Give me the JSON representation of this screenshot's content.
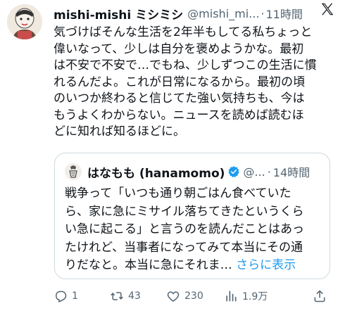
{
  "author": {
    "name": "mishi-mishi ミシミシ",
    "handle": "@mishi_mi...",
    "separator": "·",
    "time": "11時間"
  },
  "body_lines": [
    "気づけばそんな生活を2年半もしてる私ちょっと",
    "偉いなって、少しは自分を褒めようかな。最初",
    "は不安で不安で…でもね、少しずつこの生活に慣",
    "れるんだよ。これが日常になるから。最初の頃",
    "のいつか終わると信じてた強い気持ちも、今は",
    "もうよくわからない。ニュースを読めば読むほ",
    "どに知れば知るほどに。"
  ],
  "quote": {
    "name": "はなもも (hanamomo)",
    "handle": "@...",
    "separator": "·",
    "time": "14時間",
    "lines": [
      "戦争って「いつも通り朝ごはん食べていた",
      "ら、家に急にミサイル落ちてきたというくら",
      "い急に起こる」と言うのを読んだことはあっ",
      "たけれど、当事者になってみて本当にその通"
    ],
    "last_line": "りだなと。本当に急にそれま… ",
    "show_more": "さらに表示"
  },
  "actions": {
    "replies": "1",
    "reposts": "43",
    "likes": "230",
    "views": "1.9万"
  },
  "icons": {
    "logo": "x-logo-icon",
    "reply": "reply-icon",
    "repost": "repost-icon",
    "like": "heart-icon",
    "views": "views-icon",
    "share": "share-icon",
    "verified": "verified-badge-icon"
  },
  "colors": {
    "text": "#0f1419",
    "secondary": "#536471",
    "link": "#1d9bf0",
    "border": "#cfd9de"
  }
}
